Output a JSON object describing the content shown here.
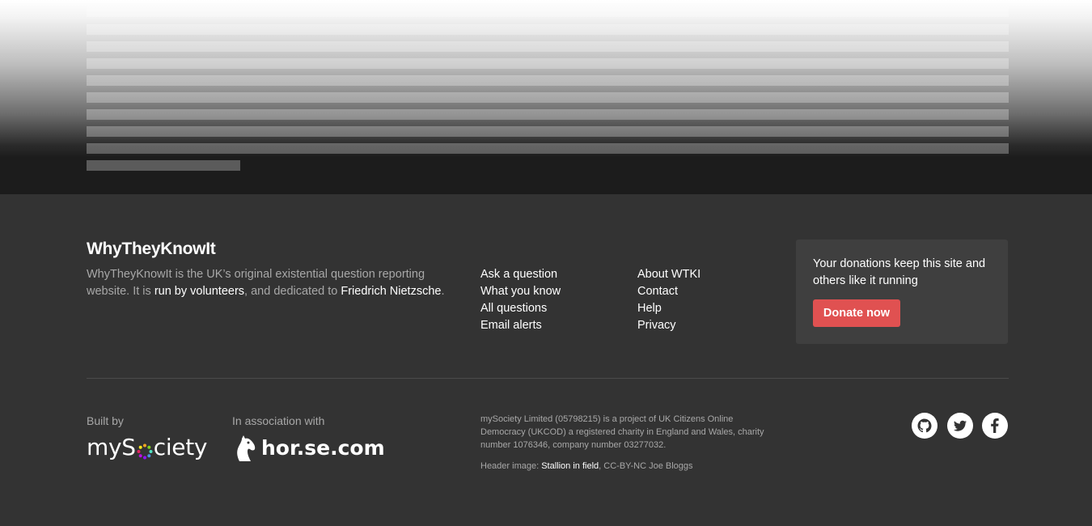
{
  "footer": {
    "site_title": "WhyTheyKnowIt",
    "description": {
      "part1": "WhyTheyKnowIt is the UK’s original existential question reporting website. It is ",
      "link1": "run by volunteers",
      "part2": ", and dedicated to ",
      "link2": "Friedrich Nietzsche",
      "part3": "."
    },
    "nav_left": [
      {
        "label": "Ask a question"
      },
      {
        "label": "What you know"
      },
      {
        "label": "All questions"
      },
      {
        "label": "Email alerts"
      }
    ],
    "nav_right": [
      {
        "label": "About WTKI"
      },
      {
        "label": "Contact"
      },
      {
        "label": "Help"
      },
      {
        "label": "Privacy"
      }
    ],
    "donate": {
      "text": "Your donations keep this site and others like it running",
      "button_label": "Donate now",
      "button_color": "#e05151"
    },
    "built_by_label": "Built by",
    "built_by_logo": {
      "prefix": "myS",
      "suffix": "ciety"
    },
    "association_label": "In association with",
    "association_logo": "hor.se.com",
    "legal": "mySociety Limited (05798215) is a project of UK Citizens Online Democracy (UKCOD) a registered charity in England and Wales, charity number 1076346, company number 03277032.",
    "credit": {
      "prefix": "Header image: ",
      "link": "Stallion in field",
      "suffix": ", CC-BY-NC Joe Bloggs"
    },
    "social": [
      "github-icon",
      "twitter-icon",
      "facebook-icon"
    ]
  },
  "colors": {
    "footer_bg": "#333333",
    "donate_box_bg": "#3f3f3f",
    "muted_text": "#a8a8a8"
  }
}
